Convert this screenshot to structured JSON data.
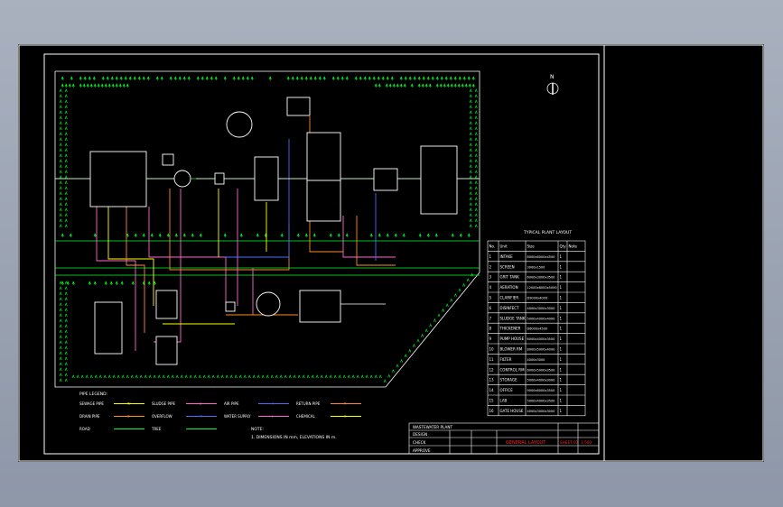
{
  "drawing": {
    "north_label": "N",
    "schedule_title": "TYPICAL PLANT LAYOUT",
    "schedule_headers": [
      "No.",
      "Unit",
      "Size",
      "Qty",
      "Note"
    ],
    "schedule_rows": [
      {
        "no": "1",
        "name": "INTAKE",
        "size": "8000x6000x4500",
        "qty": "1"
      },
      {
        "no": "2",
        "name": "SCREEN",
        "size": "3000x1500",
        "qty": "1"
      },
      {
        "no": "3",
        "name": "GRIT TANK",
        "size": "6000x3000x3500",
        "qty": "1"
      },
      {
        "no": "4",
        "name": "AERATION",
        "size": "12000x8000x5000",
        "qty": "1"
      },
      {
        "no": "5",
        "name": "CLARIFIER",
        "size": "D9000x4000",
        "qty": "1"
      },
      {
        "no": "6",
        "name": "DISINFECT",
        "size": "4000x3000x3000",
        "qty": "1"
      },
      {
        "no": "7",
        "name": "SLUDGE TANK",
        "size": "5000x4000x4000",
        "qty": "1"
      },
      {
        "no": "8",
        "name": "THICKENER",
        "size": "D6000x4500",
        "qty": "1"
      },
      {
        "no": "9",
        "name": "PUMP HOUSE",
        "size": "6000x4000x3500",
        "qty": "1"
      },
      {
        "no": "10",
        "name": "BLOWER RM",
        "size": "8000x5000x4000",
        "qty": "1"
      },
      {
        "no": "11",
        "name": "FILTER",
        "size": "4000x3000",
        "qty": "1"
      },
      {
        "no": "12",
        "name": "CONTROL RM",
        "size": "6000x5000x3500",
        "qty": "1"
      },
      {
        "no": "13",
        "name": "STORAGE",
        "size": "5000x4000x3000",
        "qty": "1"
      },
      {
        "no": "14",
        "name": "OFFICE",
        "size": "9000x6000x3500",
        "qty": "1"
      },
      {
        "no": "15",
        "name": "LAB",
        "size": "5000x4000x3500",
        "qty": "1"
      },
      {
        "no": "16",
        "name": "GATE HOUSE",
        "size": "4000x3000x3000",
        "qty": "1"
      }
    ],
    "legend": [
      {
        "label": "SEWAGE PIPE",
        "code": "W"
      },
      {
        "label": "SLUDGE PIPE",
        "code": "S"
      },
      {
        "label": "AIR PIPE",
        "code": "A"
      },
      {
        "label": "RETURN PIPE",
        "code": "R"
      },
      {
        "label": "DRAIN PIPE",
        "code": "D"
      },
      {
        "label": "OVERFLOW",
        "code": "O"
      },
      {
        "label": "WATER SUPPLY",
        "code": "J"
      },
      {
        "label": "CHEMICAL",
        "code": "C"
      },
      {
        "label": "ROAD",
        "code": ""
      },
      {
        "label": "TREE",
        "code": ""
      }
    ],
    "legend_title": "PIPE LEGEND:",
    "note_title": "NOTE:",
    "note_text": "1. DIMENSIONS IN mm, ELEVATIONS IN m.",
    "title_block": {
      "project": "WASTEWATER PLANT",
      "drawing_title": "GENERAL LAYOUT",
      "drawing_no": "SHEET 01",
      "scale": "1:500",
      "designer": "DESIGN",
      "checker": "CHECK",
      "approver": "APPROVE"
    },
    "colors": {
      "border": "#ffffff",
      "trees": "#00ff2a",
      "sewage": "#ffff00",
      "sludge": "#ff66cc",
      "air": "#4c6cff",
      "return": "#ff8a2a",
      "road": "#00ff2a",
      "title_red": "#ff2020",
      "building": "#ffffff"
    }
  }
}
